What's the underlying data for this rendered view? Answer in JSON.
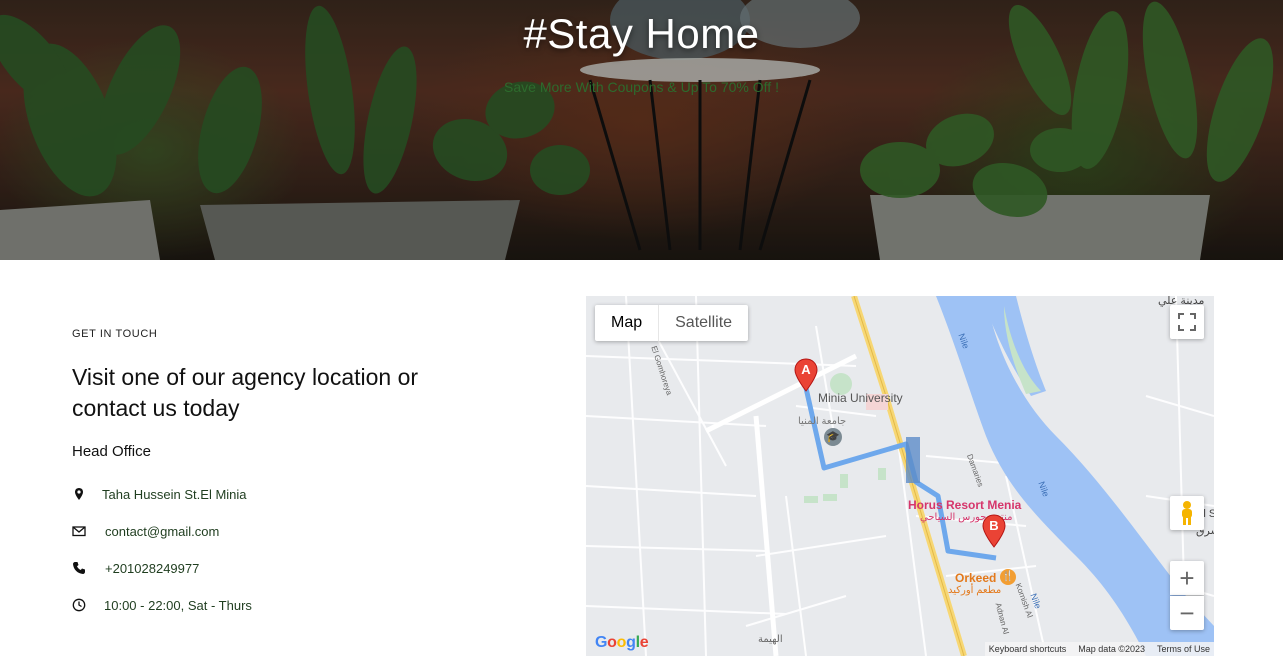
{
  "hero": {
    "title": "#Stay Home",
    "subtitle": "Save More With Coupons & Up To 70% Off !"
  },
  "contact": {
    "eyebrow": "GET IN TOUCH",
    "headline": "Visit one of our agency location or contact us today",
    "office_label": "Head Office",
    "items": [
      {
        "icon": "location-pin-icon",
        "text": "Taha Hussein St.El Minia"
      },
      {
        "icon": "envelope-icon",
        "text": "contact@gmail.com"
      },
      {
        "icon": "phone-icon",
        "text": "+201028249977"
      },
      {
        "icon": "clock-icon",
        "text": "10:00 - 22:00, Sat - Thurs"
      }
    ]
  },
  "map": {
    "type_map": "Map",
    "type_satellite": "Satellite",
    "marker_a": "A",
    "marker_b": "B",
    "labels": {
      "university_en": "Minia University",
      "university_ar": "جامعة المنيا",
      "resort_en": "Horus Resort Menia",
      "resort_ar": "منتجع حورس السياحي",
      "restaurant_en": "Orkeed",
      "restaurant_ar": "مطعم أوركيد",
      "river_1": "Nile",
      "river_2": "Nile",
      "river_3": "Nile",
      "street_1": "El Gomhoreya",
      "street_2": "Damaries",
      "street_3": "Kornish Al",
      "street_4": "Adnan Al",
      "district": "الهيمة",
      "top_right": "مدينة علي",
      "east": "El Sharq",
      "east_ar": "الشرق"
    },
    "zoom_in": "+",
    "zoom_out": "−",
    "footer": {
      "shortcuts": "Keyboard shortcuts",
      "data": "Map data ©2023",
      "terms": "Terms of Use"
    },
    "google": "Google",
    "colors": {
      "water": "#9ec2f5",
      "route": "#6ea8ec",
      "highway": "#f7d774",
      "marker": "#ea4335",
      "resort_label": "#d6356b",
      "restaurant_label": "#e3791b"
    }
  }
}
